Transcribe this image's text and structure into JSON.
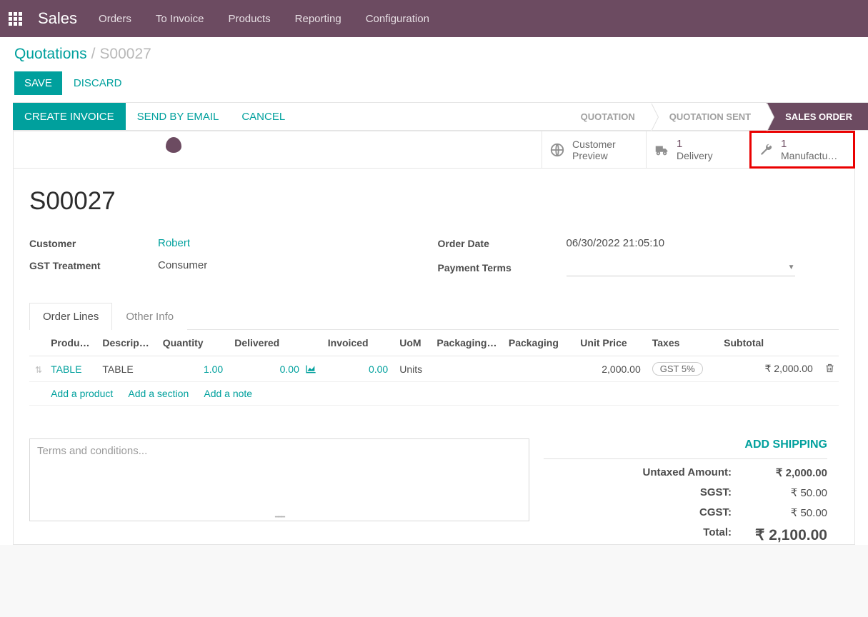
{
  "navbar": {
    "brand": "Sales",
    "items": [
      "Orders",
      "To Invoice",
      "Products",
      "Reporting",
      "Configuration"
    ]
  },
  "breadcrumb": {
    "parent": "Quotations",
    "current": "S00027"
  },
  "buttons": {
    "save": "SAVE",
    "discard": "DISCARD",
    "create_invoice": "CREATE INVOICE",
    "send_by_email": "SEND BY EMAIL",
    "cancel": "CANCEL"
  },
  "status_steps": {
    "quotation": "QUOTATION",
    "quotation_sent": "QUOTATION SENT",
    "sales_order": "SALES ORDER"
  },
  "statboxes": {
    "customer_preview": {
      "line1": "Customer",
      "line2": "Preview"
    },
    "delivery": {
      "count": "1",
      "label": "Delivery"
    },
    "manufacturing": {
      "count": "1",
      "label": "Manufactu…"
    }
  },
  "record": {
    "name": "S00027",
    "fields": {
      "customer_label": "Customer",
      "customer_value": "Robert",
      "gst_label": "GST Treatment",
      "gst_value": "Consumer",
      "order_date_label": "Order Date",
      "order_date_value": "06/30/2022 21:05:10",
      "payment_terms_label": "Payment Terms"
    }
  },
  "tabs": {
    "order_lines": "Order Lines",
    "other_info": "Other Info"
  },
  "columns": {
    "product": "Produ…",
    "description": "Descripti…",
    "quantity": "Quantity",
    "delivered": "Delivered",
    "invoiced": "Invoiced",
    "uom": "UoM",
    "packaging_qty": "Packaging …",
    "packaging": "Packaging",
    "unit_price": "Unit Price",
    "taxes": "Taxes",
    "subtotal": "Subtotal"
  },
  "lines": [
    {
      "product": "TABLE",
      "description": "TABLE",
      "quantity": "1.00",
      "delivered": "0.00",
      "invoiced": "0.00",
      "uom": "Units",
      "unit_price": "2,000.00",
      "tax": "GST 5%",
      "subtotal": "₹ 2,000.00"
    }
  ],
  "add_links": {
    "add_product": "Add a product",
    "add_section": "Add a section",
    "add_note": "Add a note"
  },
  "terms_placeholder": "Terms and conditions...",
  "totals": {
    "add_shipping": "ADD SHIPPING",
    "untaxed_label": "Untaxed Amount:",
    "untaxed_value": "₹ 2,000.00",
    "sgst_label": "SGST:",
    "sgst_value": "₹ 50.00",
    "cgst_label": "CGST:",
    "cgst_value": "₹ 50.00",
    "total_label": "Total:",
    "total_value": "₹ 2,100.00"
  }
}
